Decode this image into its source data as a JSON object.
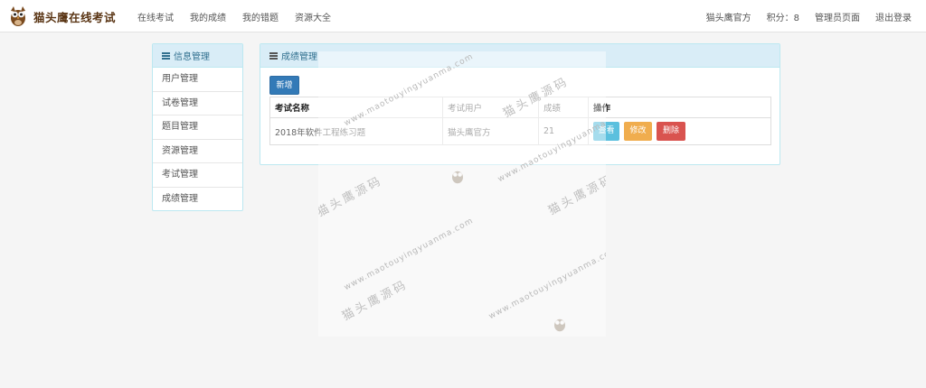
{
  "brand": {
    "title": "猫头鹰在线考试",
    "logo_icon": "owl-logo-icon"
  },
  "nav": {
    "left": [
      "在线考试",
      "我的成绩",
      "我的错题",
      "资源大全"
    ],
    "right": [
      "猫头鹰官方",
      "积分：8",
      "管理员页面",
      "退出登录"
    ]
  },
  "sidebar": {
    "title": "信息管理",
    "items": [
      "用户管理",
      "试卷管理",
      "题目管理",
      "资源管理",
      "考试管理",
      "成绩管理"
    ]
  },
  "panel": {
    "title": "成绩管理",
    "add_label": "新增",
    "columns": [
      "考试名称",
      "考试用户",
      "成绩",
      "操作"
    ],
    "rows": [
      {
        "exam": "2018年软件工程练习题",
        "user": "猫头鹰官方",
        "score": "21"
      }
    ],
    "actions": {
      "view": "查看",
      "edit": "修改",
      "delete": "删除"
    }
  },
  "watermark": {
    "site": "www.maotouyingyuanma.com",
    "name": "猫头鹰源码"
  },
  "colors": {
    "primary": "#337ab7",
    "info": "#5bc0de",
    "warning": "#f0ad4e",
    "danger": "#d9534f",
    "panel_header": "#d9edf7",
    "brand": "#5a3514"
  }
}
